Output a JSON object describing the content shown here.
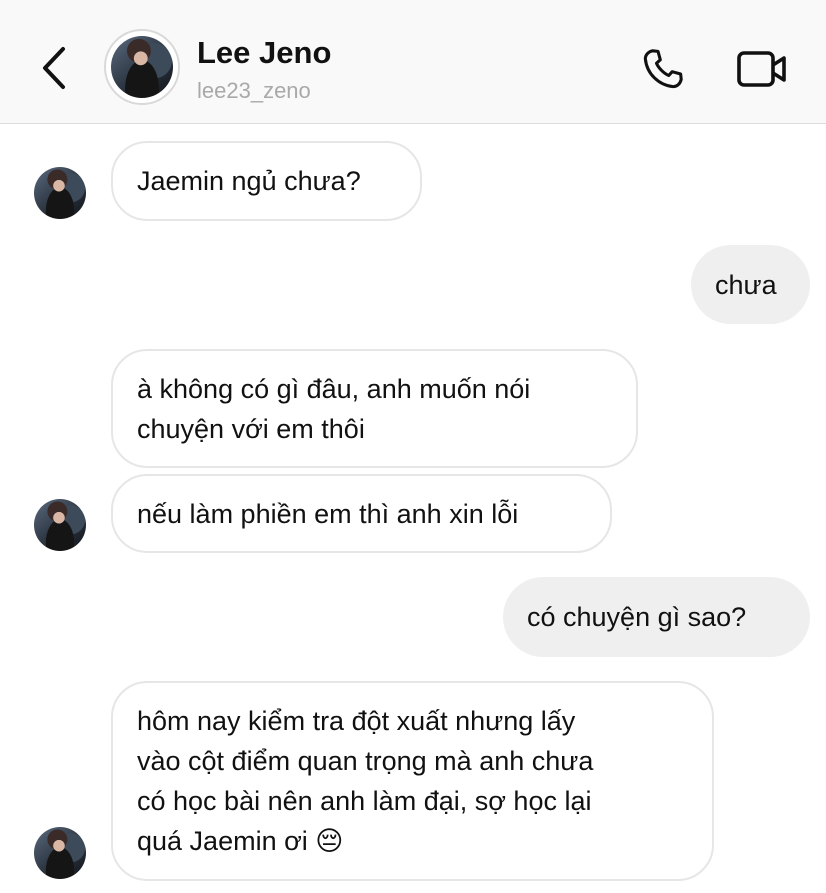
{
  "header": {
    "name": "Lee Jeno",
    "handle": "lee23_zeno",
    "icons": [
      "chevron-left-icon",
      "phone-icon",
      "video-camera-icon"
    ]
  },
  "messages": [
    {
      "direction": "incoming",
      "lines": [
        "Jaemin ngủ chưa?"
      ]
    },
    {
      "direction": "outgoing",
      "lines": [
        "chưa"
      ]
    },
    {
      "direction": "incoming",
      "lines": [
        "à không có gì đâu, anh muốn nói",
        "chuyện với em thôi"
      ]
    },
    {
      "direction": "incoming",
      "lines": [
        "nếu làm phiền em thì anh xin lỗi"
      ]
    },
    {
      "direction": "outgoing",
      "lines": [
        "có chuyện gì sao?"
      ]
    },
    {
      "direction": "incoming",
      "lines": [
        "hôm nay kiểm tra đột xuất nhưng lấy",
        "vào cột điểm quan trọng mà anh chưa",
        "có học bài nên anh làm đại, sợ học lại",
        "quá Jaemin ơi 😔"
      ]
    }
  ],
  "colors": {
    "header_bg": "#f9f9f9",
    "incoming_bubble_bg": "#ffffff",
    "incoming_bubble_border": "#e6e6e6",
    "outgoing_bubble_bg": "#efefef",
    "handle_text": "#a9a9a9"
  }
}
